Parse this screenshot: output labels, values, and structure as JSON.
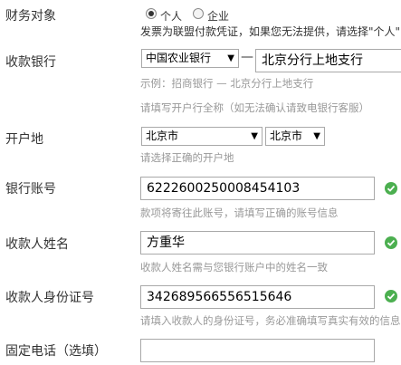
{
  "finance": {
    "label": "财务对象",
    "options": [
      {
        "label": "个人",
        "selected": true
      },
      {
        "label": "企业",
        "selected": false
      }
    ],
    "note": "发票为联盟付款凭证，如果您无法提供，请选择\"个人\""
  },
  "bank": {
    "label": "收款银行",
    "bank_select": "中国农业银行",
    "separator": "—",
    "branch_value": "北京分行上地支行",
    "example": "示例：招商银行 — 北京分行上地支行",
    "hint": "请填写开户行全称（如无法确认请致电银行客服）"
  },
  "location": {
    "label": "开户地",
    "province": "北京市",
    "city": "北京市",
    "hint": "请选择正确的开户地"
  },
  "account": {
    "label": "银行账号",
    "value": "6222600250008454103",
    "hint": "款项将寄往此账号，请填写正确的账号信息"
  },
  "payee": {
    "label": "收款人姓名",
    "value": "方重华",
    "hint": "收款人姓名需与您银行账户中的姓名一致"
  },
  "idcard": {
    "label": "收款人身份证号",
    "value": "342689566556515646",
    "hint": "请填入收款人的身份证号，务必准确填写真实有效的信息"
  },
  "phone": {
    "label": "固定电话（选填）",
    "value": ""
  },
  "colors": {
    "valid": "#4caf50",
    "hint": "#999999",
    "label": "#333333"
  }
}
